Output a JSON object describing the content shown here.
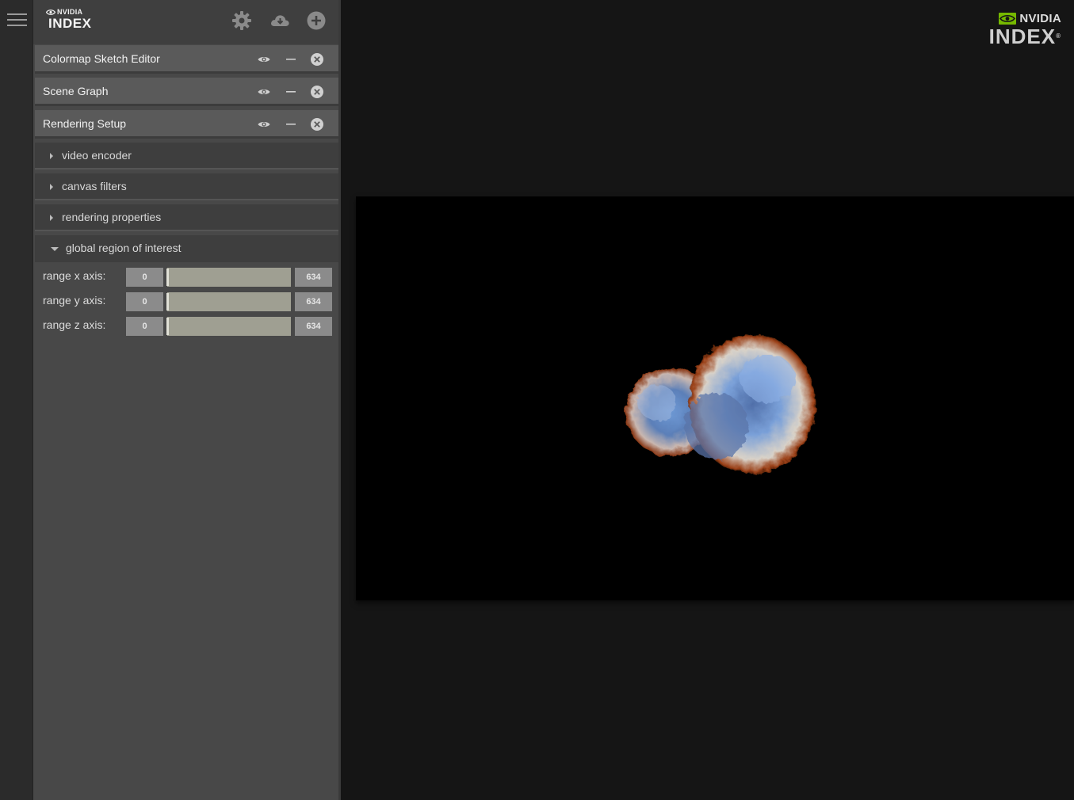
{
  "app": {
    "brand": "NVIDIA",
    "product": "INDEX",
    "registered_mark": "®"
  },
  "colors": {
    "nvidia_green": "#76b900",
    "panel_bg": "#484848",
    "window_bar": "#5a5a5a",
    "section_bg": "#3e3e3e",
    "slider_track": "#9f9f92",
    "canvas_bg": "#000000"
  },
  "header": {
    "icons": [
      "gear-icon",
      "cloud-download-icon",
      "add-circle-icon"
    ]
  },
  "windows": [
    {
      "title": "Colormap Sketch Editor",
      "icons": [
        "eye-icon",
        "minimize-icon",
        "close-icon"
      ]
    },
    {
      "title": "Scene Graph",
      "icons": [
        "eye-icon",
        "minimize-icon",
        "close-icon"
      ]
    },
    {
      "title": "Rendering Setup",
      "icons": [
        "eye-icon",
        "minimize-icon",
        "close-icon"
      ]
    }
  ],
  "sections": [
    {
      "label": "video encoder",
      "expanded": false
    },
    {
      "label": "canvas filters",
      "expanded": false
    },
    {
      "label": "rendering properties",
      "expanded": false
    },
    {
      "label": "global region of interest",
      "expanded": true
    }
  ],
  "roi": [
    {
      "label": "range x axis:",
      "min": "0",
      "max": "634",
      "range_min": 0,
      "range_max": 634
    },
    {
      "label": "range y axis:",
      "min": "0",
      "max": "634",
      "range_min": 0,
      "range_max": 634
    },
    {
      "label": "range z axis:",
      "min": "0",
      "max": "634",
      "range_min": 0,
      "range_max": 634
    }
  ]
}
